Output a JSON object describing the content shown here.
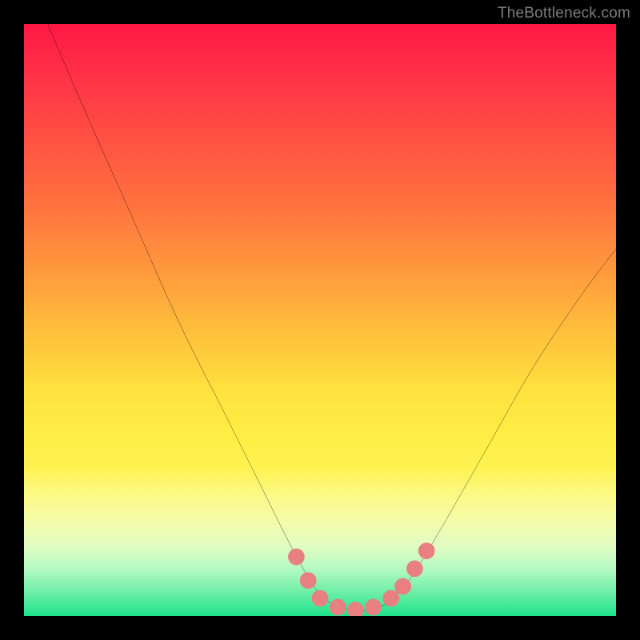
{
  "watermark": "TheBottleneck.com",
  "chart_data": {
    "type": "line",
    "title": "",
    "xlabel": "",
    "ylabel": "",
    "xlim": [
      0,
      100
    ],
    "ylim": [
      0,
      100
    ],
    "gradient_stops": [
      {
        "pos": 0,
        "color": "#ff1846"
      },
      {
        "pos": 12,
        "color": "#ff3b46"
      },
      {
        "pos": 28,
        "color": "#ff6a3f"
      },
      {
        "pos": 40,
        "color": "#ff933d"
      },
      {
        "pos": 52,
        "color": "#ffbf3c"
      },
      {
        "pos": 62,
        "color": "#ffe23e"
      },
      {
        "pos": 70,
        "color": "#ffee45"
      },
      {
        "pos": 75,
        "color": "#fff352"
      },
      {
        "pos": 80,
        "color": "#fbf98a"
      },
      {
        "pos": 84,
        "color": "#f4fca9"
      },
      {
        "pos": 88,
        "color": "#e3fcc2"
      },
      {
        "pos": 92,
        "color": "#b5f9c4"
      },
      {
        "pos": 96,
        "color": "#6deea6"
      },
      {
        "pos": 100,
        "color": "#1fe28a"
      }
    ],
    "series": [
      {
        "name": "bottleneck-curve",
        "color": "#000000",
        "points": [
          {
            "x": 4,
            "y": 100
          },
          {
            "x": 10,
            "y": 86
          },
          {
            "x": 18,
            "y": 68
          },
          {
            "x": 26,
            "y": 50
          },
          {
            "x": 34,
            "y": 34
          },
          {
            "x": 40,
            "y": 22
          },
          {
            "x": 45,
            "y": 12
          },
          {
            "x": 49,
            "y": 5
          },
          {
            "x": 52,
            "y": 2
          },
          {
            "x": 55,
            "y": 1
          },
          {
            "x": 58,
            "y": 1
          },
          {
            "x": 61,
            "y": 2
          },
          {
            "x": 65,
            "y": 6
          },
          {
            "x": 70,
            "y": 14
          },
          {
            "x": 78,
            "y": 28
          },
          {
            "x": 86,
            "y": 42
          },
          {
            "x": 94,
            "y": 54
          },
          {
            "x": 100,
            "y": 62
          }
        ]
      }
    ],
    "markers": [
      {
        "x": 46,
        "y": 10,
        "r": 1.4,
        "color": "#e97f80"
      },
      {
        "x": 48,
        "y": 6,
        "r": 1.4,
        "color": "#e97f80"
      },
      {
        "x": 50,
        "y": 3,
        "r": 1.4,
        "color": "#e97f80"
      },
      {
        "x": 53,
        "y": 1.5,
        "r": 1.4,
        "color": "#e97f80"
      },
      {
        "x": 56,
        "y": 1,
        "r": 1.4,
        "color": "#e97f80"
      },
      {
        "x": 59,
        "y": 1.5,
        "r": 1.4,
        "color": "#e97f80"
      },
      {
        "x": 62,
        "y": 3,
        "r": 1.4,
        "color": "#e97f80"
      },
      {
        "x": 64,
        "y": 5,
        "r": 1.4,
        "color": "#e97f80"
      },
      {
        "x": 66,
        "y": 8,
        "r": 1.4,
        "color": "#e97f80"
      },
      {
        "x": 68,
        "y": 11,
        "r": 1.4,
        "color": "#e97f80"
      }
    ]
  }
}
